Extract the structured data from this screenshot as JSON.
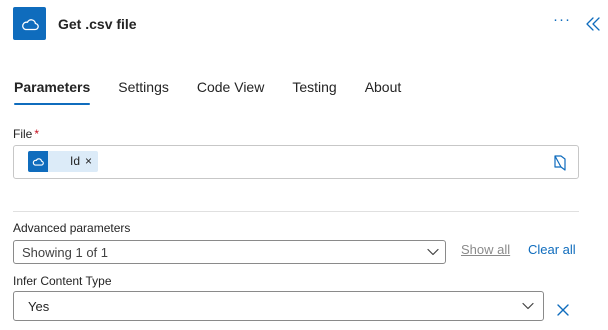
{
  "header": {
    "title": "Get .csv file",
    "app_icon": "onedrive-cloud-icon",
    "more_label": "···",
    "brand_color": "#0f6cbd"
  },
  "tabs": [
    {
      "label": "Parameters",
      "active": true
    },
    {
      "label": "Settings",
      "active": false
    },
    {
      "label": "Code View",
      "active": false
    },
    {
      "label": "Testing",
      "active": false
    },
    {
      "label": "About",
      "active": false
    }
  ],
  "file_field": {
    "label": "File",
    "required_mark": "*",
    "token_label": "Id",
    "token_remove": "×",
    "token_icon": "onedrive-cloud-icon",
    "picker_icon": "folder-picker-icon"
  },
  "advanced": {
    "label": "Advanced parameters",
    "selected": "Showing 1 of 1",
    "show_all": "Show all",
    "clear_all": "Clear all"
  },
  "infer_content_type": {
    "label": "Infer Content Type",
    "selected": "Yes"
  }
}
